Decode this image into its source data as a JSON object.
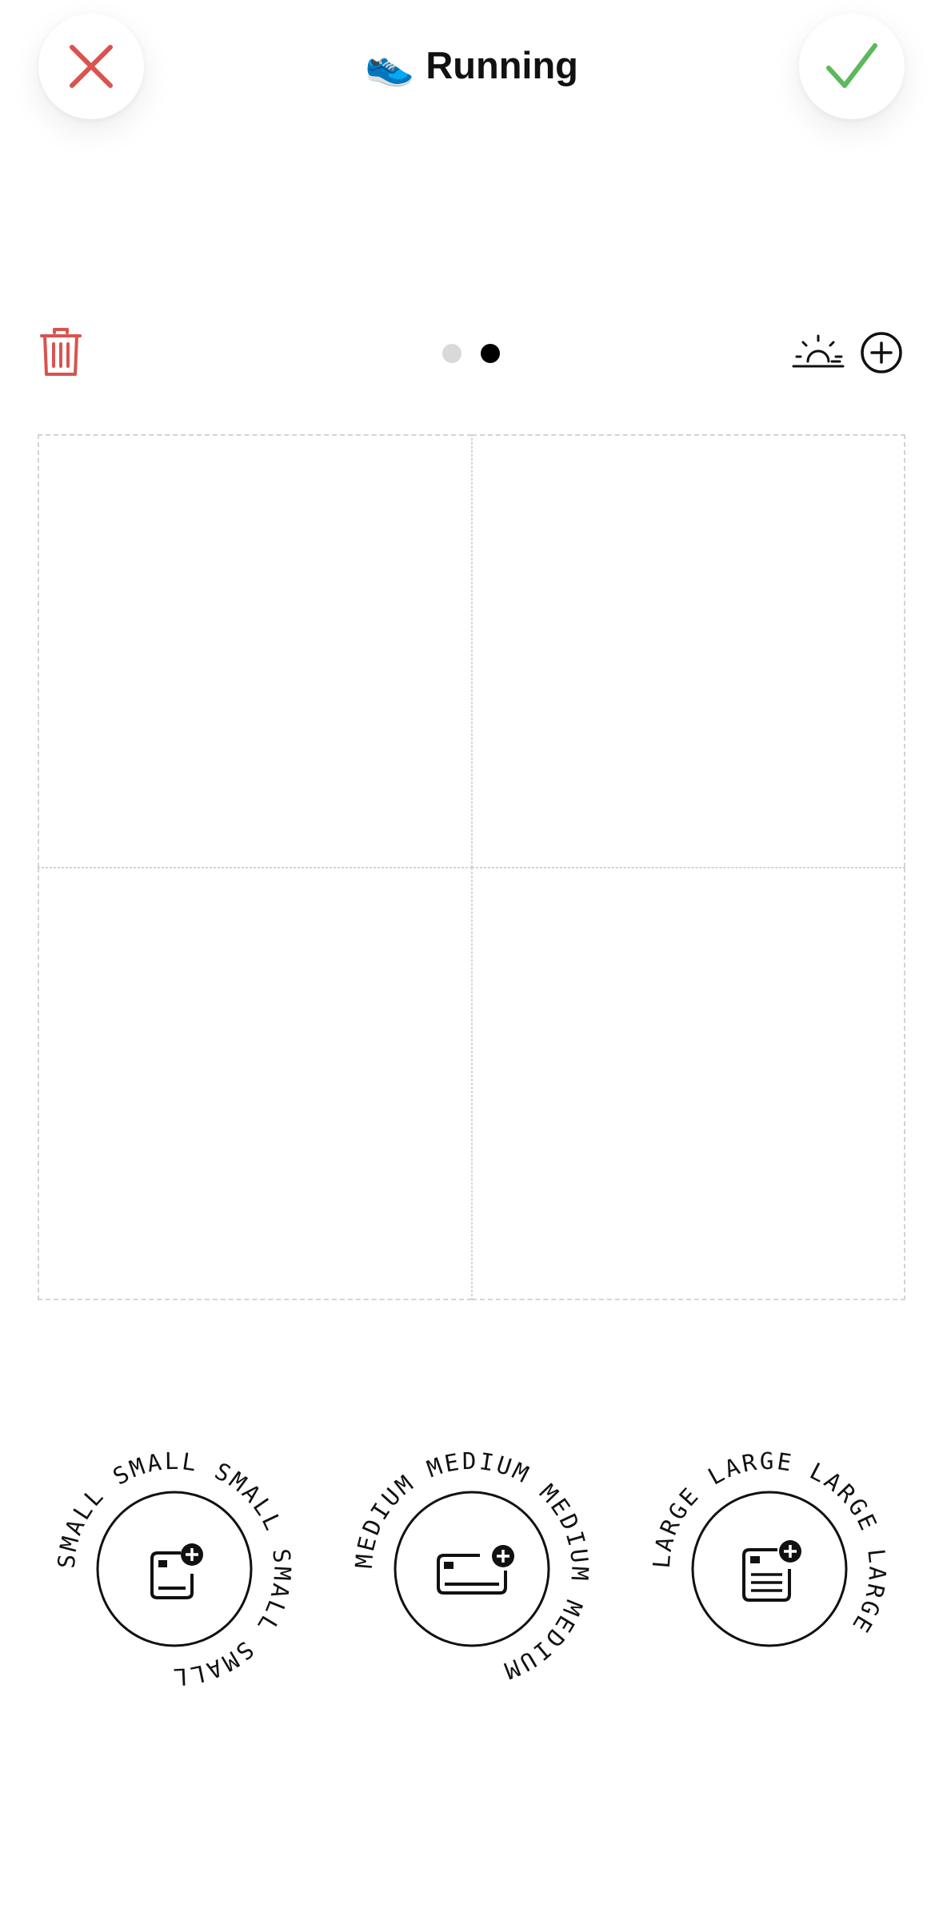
{
  "header": {
    "title_emoji": "👟",
    "title": "Running",
    "close_color": "#d9534f",
    "confirm_color": "#5cb85c"
  },
  "toolbar": {
    "delete_color": "#d9534f",
    "pages": {
      "count": 2,
      "active_index": 1
    },
    "active_dot_color": "#000000",
    "inactive_dot_color": "#d9d9d9",
    "icons": [
      "sunrise-icon",
      "add-circle-icon"
    ]
  },
  "grid": {
    "rows": 2,
    "columns": 2,
    "border_color": "#d4d4d4"
  },
  "widget_sizes": [
    {
      "ring_text": "SMALL SMALL SMALL SMALL SMALL ",
      "icon": "add-small-widget-icon"
    },
    {
      "ring_text": "MEDIUM MEDIUM MEDIUM MEDIUM ",
      "icon": "add-medium-widget-icon"
    },
    {
      "ring_text": "LARGE LARGE LARGE LARGE ",
      "icon": "add-large-widget-icon"
    }
  ]
}
